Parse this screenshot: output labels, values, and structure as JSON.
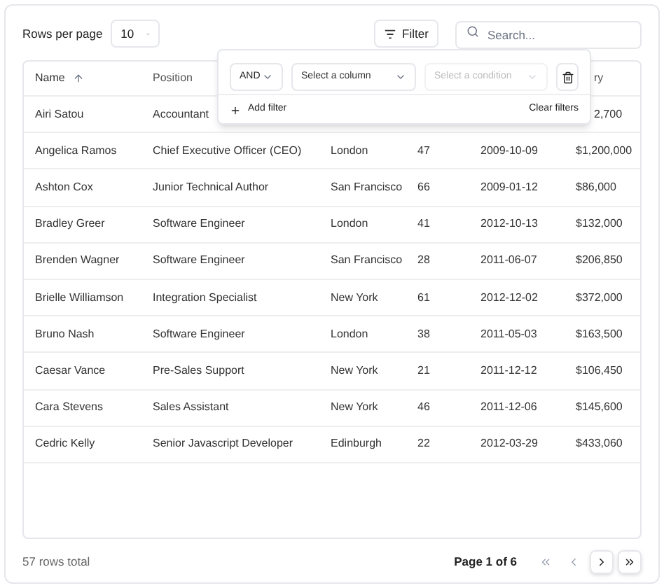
{
  "toolbar": {
    "rows_per_page_label": "Rows per page",
    "rows_per_page": "10",
    "filter_button": "Filter",
    "search": {
      "placeholder": "Search..."
    }
  },
  "table": {
    "columns": [
      {
        "label": "Name",
        "sorted": true
      },
      {
        "label": "Position",
        "sorted": false
      },
      {},
      {},
      {},
      {
        "label": "ry",
        "sorted": false
      }
    ],
    "rows": [
      [
        "Airi Satou",
        "Accountant",
        "",
        "",
        "",
        "2,700"
      ],
      [
        "Angelica Ramos",
        "Chief Executive Officer (CEO)",
        "London",
        "47",
        "2009-10-09",
        "$1,200,000"
      ],
      [
        "Ashton Cox",
        "Junior Technical Author",
        "San Francisco",
        "66",
        "2009-01-12",
        "$86,000"
      ],
      [
        "Bradley Greer",
        "Software Engineer",
        "London",
        "41",
        "2012-10-13",
        "$132,000"
      ],
      [
        "Brenden Wagner",
        "Software Engineer",
        "San Francisco",
        "28",
        "2011-06-07",
        "$206,850"
      ],
      [
        "Brielle Williamson",
        "Integration Specialist",
        "New York",
        "61",
        "2012-12-02",
        "$372,000"
      ],
      [
        "Bruno Nash",
        "Software Engineer",
        "London",
        "38",
        "2011-05-03",
        "$163,500"
      ],
      [
        "Caesar Vance",
        "Pre-Sales Support",
        "New York",
        "21",
        "2011-12-12",
        "$106,450"
      ],
      [
        "Cara Stevens",
        "Sales Assistant",
        "New York",
        "46",
        "2011-12-06",
        "$145,600"
      ],
      [
        "Cedric Kelly",
        "Senior Javascript Developer",
        "Edinburgh",
        "22",
        "2012-03-29",
        "$433,060"
      ]
    ]
  },
  "filter_popover": {
    "operator": "AND",
    "column_select": {
      "placeholder": "Select a column"
    },
    "condition_select": {
      "placeholder": "Select a condition",
      "disabled": true
    },
    "add_filter": "Add filter",
    "clear_filters": "Clear filters"
  },
  "footer": {
    "total": "57 rows total",
    "page": "Page 1 of 6",
    "buttons": [
      {
        "kind": "first",
        "disabled": true
      },
      {
        "kind": "prev",
        "disabled": true
      },
      {
        "kind": "next",
        "disabled": false
      },
      {
        "kind": "last",
        "disabled": false
      }
    ]
  }
}
